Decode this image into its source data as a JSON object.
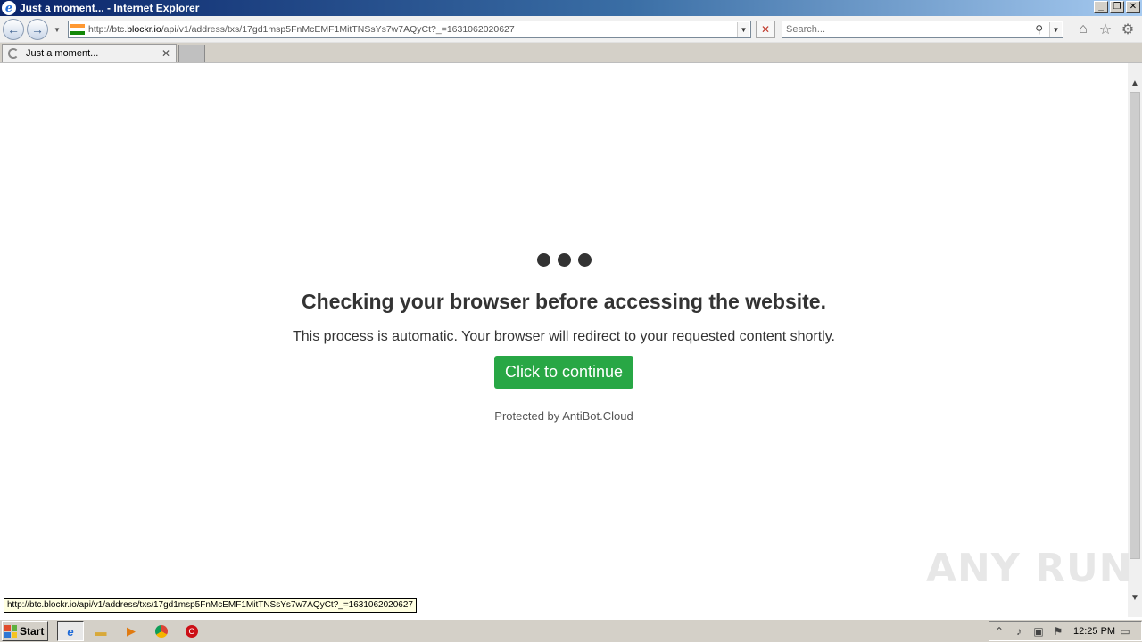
{
  "window": {
    "title": "Just a moment... - Internet Explorer",
    "minimize": "_",
    "restore": "❐",
    "close": "✕"
  },
  "toolbar": {
    "back_icon": "←",
    "forward_icon": "→",
    "address_prefix": "http://btc.",
    "address_domain": "blockr.io",
    "address_path": "/api/v1/address/txs/17gd1msp5FnMcEMF1MitTNSsYs7w7AQyCt?_=1631062020627",
    "search_placeholder": "Search...",
    "stop_icon": "✕"
  },
  "tabs": [
    {
      "label": "Just a moment...",
      "close": "✕"
    }
  ],
  "page": {
    "heading": "Checking your browser before accessing the website.",
    "subtext": "This process is automatic. Your browser will redirect to your requested content shortly.",
    "button_label": "Click to continue",
    "protected_prefix": "Protected by",
    "protected_by": "AntiBot.Cloud"
  },
  "status": {
    "url": "http://btc.blockr.io/api/v1/address/txs/17gd1msp5FnMcEMF1MitTNSsYs7w7AQyCt?_=1631062020627"
  },
  "watermark": "ANY RUN",
  "taskbar": {
    "start_label": "Start",
    "clock": "12:25 PM"
  },
  "colors": {
    "accent_button": "#28a745",
    "heading": "#333333",
    "protected_text": "#6c757d"
  }
}
